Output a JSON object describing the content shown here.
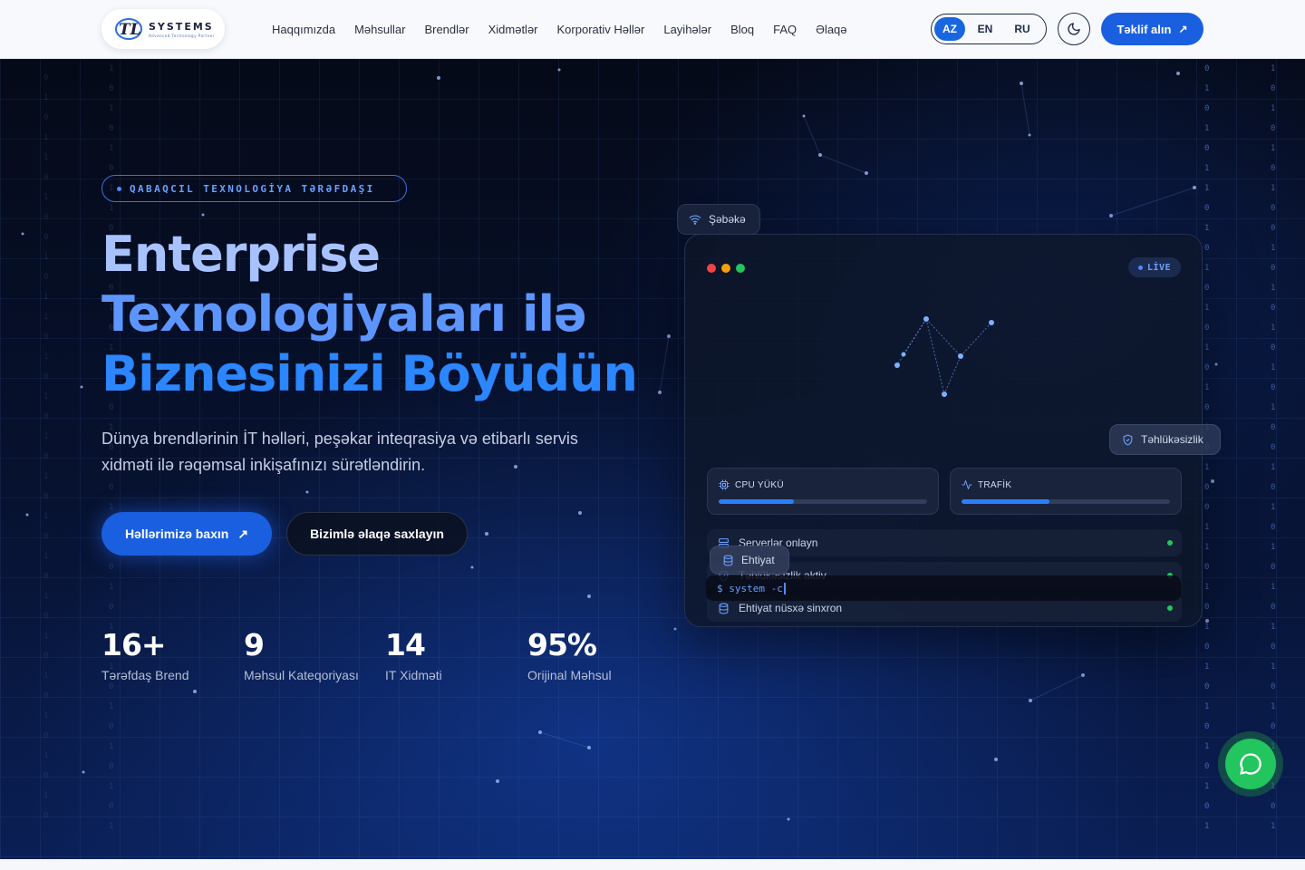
{
  "brand": {
    "name": "SYSTEMS",
    "tagline": "Advanced Technology Partner",
    "mark": "TL"
  },
  "nav": {
    "items": [
      "Haqqımızda",
      "Məhsullar",
      "Brendlər",
      "Xidmətlər",
      "Korporativ Həllər",
      "Layihələr",
      "Bloq",
      "FAQ",
      "Əlaqə"
    ],
    "languages": [
      "AZ",
      "EN",
      "RU"
    ],
    "active_language": "AZ",
    "cta_label": "Təklif alın"
  },
  "hero": {
    "badge": "QABAQCIL TEXNOLOGİYA TƏRƏFDAŞI",
    "title_lines": [
      "Enterprise",
      "Texnologiyaları ilə",
      "Biznesinizi Böyüdün"
    ],
    "subtitle": "Dünya brendlərinin İT həlləri, peşəkar inteqrasiya və etibarlı servis xidməti ilə rəqəmsal inkişafınızı sürətləndirin.",
    "primary_button": "Həllərimizə baxın",
    "secondary_button": "Bizimlə əlaqə saxlayın",
    "stats": [
      {
        "value": "16+",
        "label": "Tərəfdaş Brend"
      },
      {
        "value": "9",
        "label": "Məhsul Kateqoriyası"
      },
      {
        "value": "14",
        "label": "IT Xidməti"
      },
      {
        "value": "95%",
        "label": "Orijinal Məhsul"
      }
    ]
  },
  "dashboard": {
    "network_tag": "Şəbəkə",
    "live_label": "LİVE",
    "metrics": [
      {
        "label": "CPU YÜKÜ",
        "fill": 0.36,
        "icon": "cpu-icon"
      },
      {
        "label": "TRAFİK",
        "fill": 0.42,
        "icon": "activity-icon"
      }
    ],
    "floating_security": "Təhlükəsizlik",
    "status_rows": [
      {
        "label": "Serverlər onlayn",
        "icon": "server-icon"
      },
      {
        "label": "Təhlükəsizlik aktiv",
        "icon": "shield-icon"
      },
      {
        "label": "Ehtiyat nüsxə sinxron",
        "icon": "database-icon"
      }
    ],
    "terminal_prompt": "$ system -c",
    "floating_backup": "Ehtiyat"
  },
  "colors": {
    "accent": "#1a5fe0",
    "status_ok": "#22c55e",
    "whatsapp": "#22c55e"
  }
}
